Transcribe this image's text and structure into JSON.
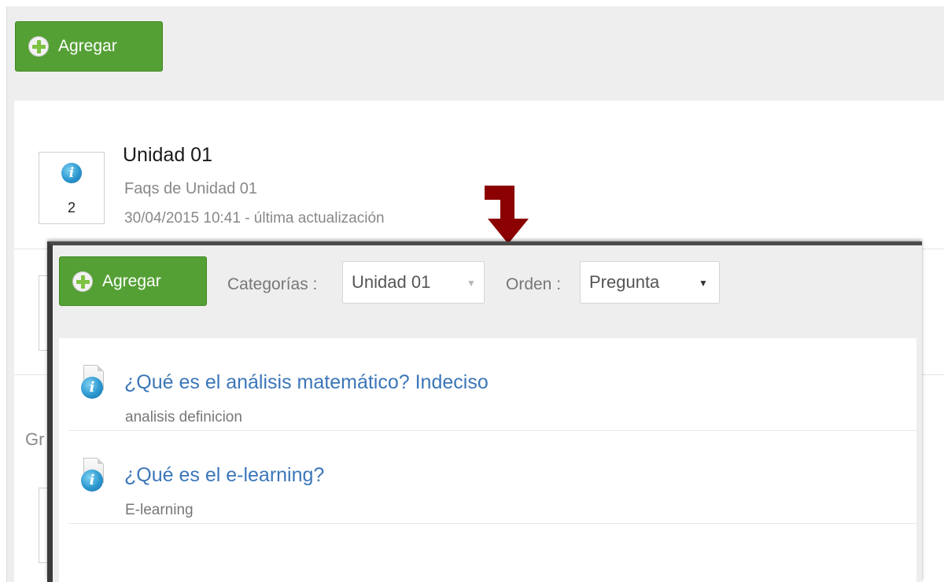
{
  "background_page": {
    "add_button_label": "Agregar",
    "unit": {
      "title": "Unidad 01",
      "subtitle": "Faqs de Unidad 01",
      "updated": "30/04/2015 10:41 - última actualización",
      "count": "2"
    },
    "partial_text": "Gr"
  },
  "overlay": {
    "add_button_label": "Agregar",
    "categories_label": "Categorías :",
    "categories_value": "Unidad 01",
    "order_label": "Orden :",
    "order_value": "Pregunta",
    "faqs": [
      {
        "title": "¿Qué es el análisis matemático? Indeciso",
        "tags": "analisis definicion"
      },
      {
        "title": "¿Qué es el e-learning?",
        "tags": "E-learning"
      }
    ]
  },
  "colors": {
    "add_button": "#55a035",
    "link": "#3b76b8",
    "arrow": "#8b0000",
    "info_icon": "#2b97cf"
  },
  "icons": {
    "add": "plus-circle-icon",
    "info": "info-icon",
    "faq": "document-info-icon",
    "dropdown": "caret-down-icon",
    "pointer": "down-arrow-icon"
  }
}
